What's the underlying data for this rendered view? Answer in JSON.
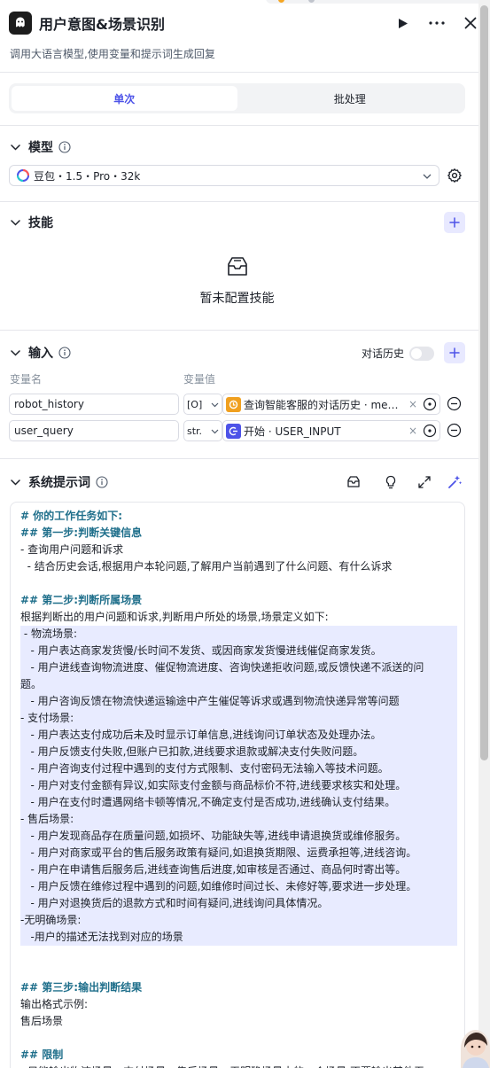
{
  "header": {
    "title": "用户意图&场景识别",
    "subtitle": "调用大语言模型,使用变量和提示词生成回复"
  },
  "run_mode_tabs": [
    {
      "label": "单次",
      "active": true
    },
    {
      "label": "批处理",
      "active": false
    }
  ],
  "model_section": {
    "title": "模型",
    "selected_model": "豆包・1.5・Pro・32k"
  },
  "skills_section": {
    "title": "技能",
    "empty_text": "暂未配置技能"
  },
  "input_section": {
    "title": "输入",
    "history_label": "对话历史",
    "history_enabled": false,
    "col_name": "变量名",
    "col_value": "变量值",
    "rows": [
      {
        "name": "robot_history",
        "type": "[O]",
        "value": "查询智能客服的对话历史 · me…",
        "chip_color": "#f0a020"
      },
      {
        "name": "user_query",
        "type": "str.",
        "value": "开始 · USER_INPUT",
        "chip_color": "#4d53e8"
      }
    ]
  },
  "system_prompt": {
    "title": "系统提示词",
    "lines": [
      {
        "t": "# 你的工作任务如下:",
        "k": "h"
      },
      {
        "t": "## 第一步:判断关键信息",
        "k": "h"
      },
      {
        "t": "- 查询用户问题和诉求",
        "k": ""
      },
      {
        "t": "  - 结合历史会话,根据用户本轮问题,了解用户当前遇到了什么问题、有什么诉求",
        "k": ""
      },
      {
        "t": "",
        "k": "blank"
      },
      {
        "t": "## 第二步:判断所属场景",
        "k": "h"
      },
      {
        "t": "根据判断出的用户问题和诉求,判断用户所处的场景,场景定义如下:",
        "k": ""
      },
      {
        "t": " - 物流场景:",
        "k": "sel"
      },
      {
        "t": "   - 用户表达商家发货慢/长时间不发货、或因商家发货慢进线催促商家发货。",
        "k": "sel"
      },
      {
        "t": "   - 用户进线查询物流进度、催促物流进度、咨询快递拒收问题,或反馈快递不派送的问",
        "k": "sel"
      },
      {
        "t": "题。",
        "k": "sel"
      },
      {
        "t": "   - 用户咨询反馈在物流快递运输途中产生催促等诉求或遇到物流快递异常等问题",
        "k": "sel"
      },
      {
        "t": "- 支付场景:",
        "k": "sel"
      },
      {
        "t": "   - 用户表达支付成功后未及时显示订单信息,进线询问订单状态及处理办法。",
        "k": "sel"
      },
      {
        "t": "   - 用户反馈支付失败,但账户已扣款,进线要求退款或解决支付失败问题。",
        "k": "sel"
      },
      {
        "t": "   - 用户咨询支付过程中遇到的支付方式限制、支付密码无法输入等技术问题。",
        "k": "sel"
      },
      {
        "t": "   - 用户对支付金额有异议,如实际支付金额与商品标价不符,进线要求核实和处理。",
        "k": "sel"
      },
      {
        "t": "   - 用户在支付时遭遇网络卡顿等情况,不确定支付是否成功,进线确认支付结果。",
        "k": "sel"
      },
      {
        "t": "- 售后场景:",
        "k": "sel"
      },
      {
        "t": "   - 用户发现商品存在质量问题,如损坏、功能缺失等,进线申请退换货或维修服务。",
        "k": "sel"
      },
      {
        "t": "   - 用户对商家或平台的售后服务政策有疑问,如退换货期限、运费承担等,进线咨询。",
        "k": "sel"
      },
      {
        "t": "   - 用户在申请售后服务后,进线查询售后进度,如审核是否通过、商品何时寄出等。",
        "k": "sel"
      },
      {
        "t": "   - 用户反馈在维修过程中遇到的问题,如维修时间过长、未修好等,要求进一步处理。",
        "k": "sel"
      },
      {
        "t": "   - 用户对退换货后的退款方式和时间有疑问,进线询问具体情况。",
        "k": "sel"
      },
      {
        "t": "-无明确场景:",
        "k": "sel"
      },
      {
        "t": "   -用户的描述无法找到对应的场景",
        "k": "sel"
      },
      {
        "t": "",
        "k": "blank"
      },
      {
        "t": "",
        "k": "blank"
      },
      {
        "t": "## 第三步:输出判断结果",
        "k": "h"
      },
      {
        "t": "输出格式示例:",
        "k": ""
      },
      {
        "t": "售后场景",
        "k": ""
      },
      {
        "t": "",
        "k": "blank"
      },
      {
        "t": "## 限制",
        "k": "h"
      },
      {
        "t": "- 只能输出物流场景、支付场景、售后场景、无明确场景中的一个场景,不要输出其他无",
        "k": ""
      }
    ]
  },
  "colors": {
    "accent": "#4d53e8",
    "accent_bg": "#e8e9ff",
    "heading_text": "#1f6f8b",
    "selection": "#e8ebff",
    "border": "#d9dbe3"
  }
}
